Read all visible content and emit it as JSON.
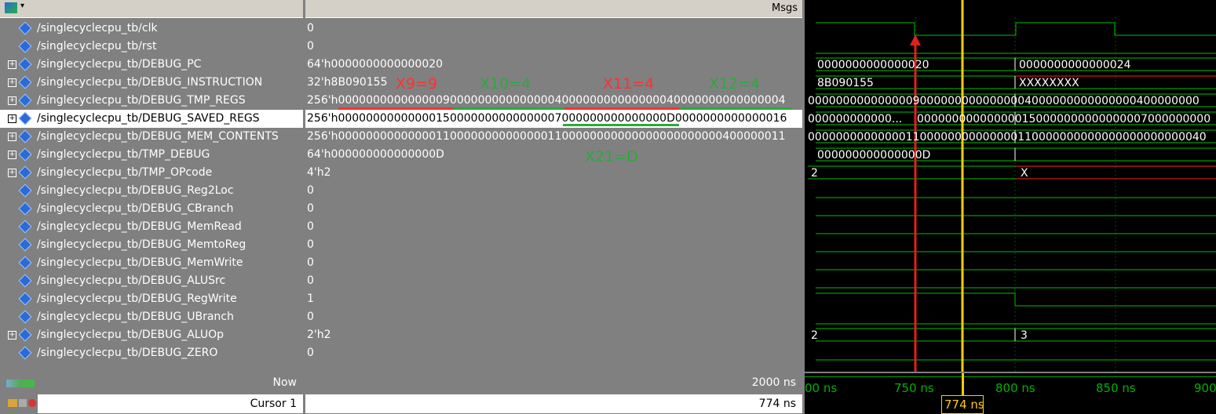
{
  "header": {
    "msgs_label": "Msgs"
  },
  "signals": [
    {
      "name": "/singlecyclecpu_tb/clk",
      "value": "0",
      "expandable": false
    },
    {
      "name": "/singlecyclecpu_tb/rst",
      "value": "0",
      "expandable": false
    },
    {
      "name": "/singlecyclecpu_tb/DEBUG_PC",
      "value": "64'h0000000000000020",
      "expandable": true
    },
    {
      "name": "/singlecyclecpu_tb/DEBUG_INSTRUCTION",
      "value": "32'h8B090155",
      "expandable": true
    },
    {
      "name": "/singlecyclecpu_tb/DEBUG_TMP_REGS",
      "value": "256'h0000000000000009000000000000000400000000000000040000000000000004",
      "expandable": true
    },
    {
      "name": "/singlecyclecpu_tb/DEBUG_SAVED_REGS",
      "value": "256'h00000000000000150000000000000007000000000000000D0000000000000016",
      "expandable": true,
      "selected": true
    },
    {
      "name": "/singlecyclecpu_tb/DEBUG_MEM_CONTENTS",
      "value": "256'h0000000000000011000000000000001100000000000000000000000400000011",
      "expandable": true
    },
    {
      "name": "/singlecyclecpu_tb/TMP_DEBUG",
      "value": "64'h000000000000000D",
      "expandable": true
    },
    {
      "name": "/singlecyclecpu_tb/TMP_OPcode",
      "value": "4'h2",
      "expandable": true
    },
    {
      "name": "/singlecyclecpu_tb/DEBUG_Reg2Loc",
      "value": "0",
      "expandable": false
    },
    {
      "name": "/singlecyclecpu_tb/DEBUG_CBranch",
      "value": "0",
      "expandable": false
    },
    {
      "name": "/singlecyclecpu_tb/DEBUG_MemRead",
      "value": "0",
      "expandable": false
    },
    {
      "name": "/singlecyclecpu_tb/DEBUG_MemtoReg",
      "value": "0",
      "expandable": false
    },
    {
      "name": "/singlecyclecpu_tb/DEBUG_MemWrite",
      "value": "0",
      "expandable": false
    },
    {
      "name": "/singlecyclecpu_tb/DEBUG_ALUSrc",
      "value": "0",
      "expandable": false
    },
    {
      "name": "/singlecyclecpu_tb/DEBUG_RegWrite",
      "value": "1",
      "expandable": false
    },
    {
      "name": "/singlecyclecpu_tb/DEBUG_UBranch",
      "value": "0",
      "expandable": false
    },
    {
      "name": "/singlecyclecpu_tb/DEBUG_ALUOp",
      "value": "2'h2",
      "expandable": true
    },
    {
      "name": "/singlecyclecpu_tb/DEBUG_ZERO",
      "value": "0",
      "expandable": false
    }
  ],
  "annotations": {
    "x9": "X9=9",
    "x10": "X10=4",
    "x11": "X11=4",
    "x12": "X12=4",
    "x21": "X21=D"
  },
  "wave": {
    "pc_a": "0000000000000020",
    "pc_b": "0000000000000024",
    "instr_a": "8B090155",
    "instr_b": "XXXXXXXX",
    "tmp_regs": "00000000000000090000000000000004000000000000000400000000",
    "saved_a": "000000000000...",
    "saved_b": "000000000000000150000000000000007000000000",
    "mem": "000000000000001100000000000000110000000000000000000000040",
    "tmp_debug": "000000000000000D",
    "opcode_a": "2",
    "opcode_b": "X",
    "aluop_a": "2",
    "aluop_b": "3"
  },
  "footer": {
    "now_label": "Now",
    "now_value": "2000 ns",
    "cursor_label": "Cursor 1",
    "cursor_value": "774 ns",
    "ticks": [
      "00 ns",
      "750 ns",
      "800 ns",
      "850 ns",
      "900"
    ],
    "cursor_marker": "774 ns"
  },
  "colors": {
    "waveform": "#00c000",
    "cursor": "#ffcc00",
    "arrow": "#e02020",
    "undefined": "#ff2020"
  }
}
